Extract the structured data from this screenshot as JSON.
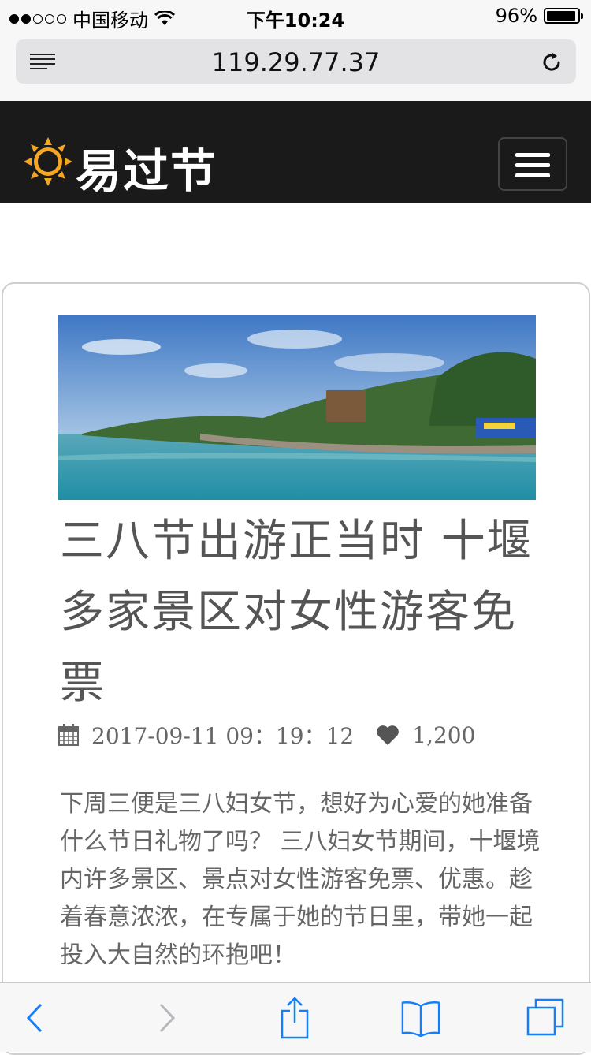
{
  "status_bar": {
    "carrier": "中国移动",
    "time": "下午10:24",
    "battery_percent": "96%",
    "battery_level": 0.96,
    "signal_bars_filled": 2,
    "signal_bars_total": 5
  },
  "browser": {
    "url": "119.29.77.37",
    "icons": {
      "reader": "reader-view-icon",
      "reload": "reload-icon"
    }
  },
  "site": {
    "brand": "易过节",
    "logo_icon": "sun-icon",
    "menu_icon": "hamburger-menu-icon",
    "colors": {
      "navbar_bg": "#1a1a1a",
      "logo_orange": "#f5a623",
      "text_gray": "#555555",
      "ios_blue": "#157efb"
    }
  },
  "article": {
    "title": "三八节出游正当时 十堰多家景区对女性游客免票",
    "datetime": "2017-09-11 09：19：12",
    "likes": "1,200",
    "body": "下周三便是三八妇女节，想好为心爱的她准备什么节日礼物了吗？ 三八妇女节期间，十堰境内许多景区、景点对女性游客免票、优惠。趁着春意浓浓，在专属于她的节日里，带她一起投入大自然的环抱吧！"
  },
  "toolbar": {
    "back": "back-chevron-icon",
    "forward": "forward-chevron-icon",
    "share": "share-icon",
    "bookmarks": "bookmarks-book-icon",
    "tabs": "tabs-icon"
  }
}
